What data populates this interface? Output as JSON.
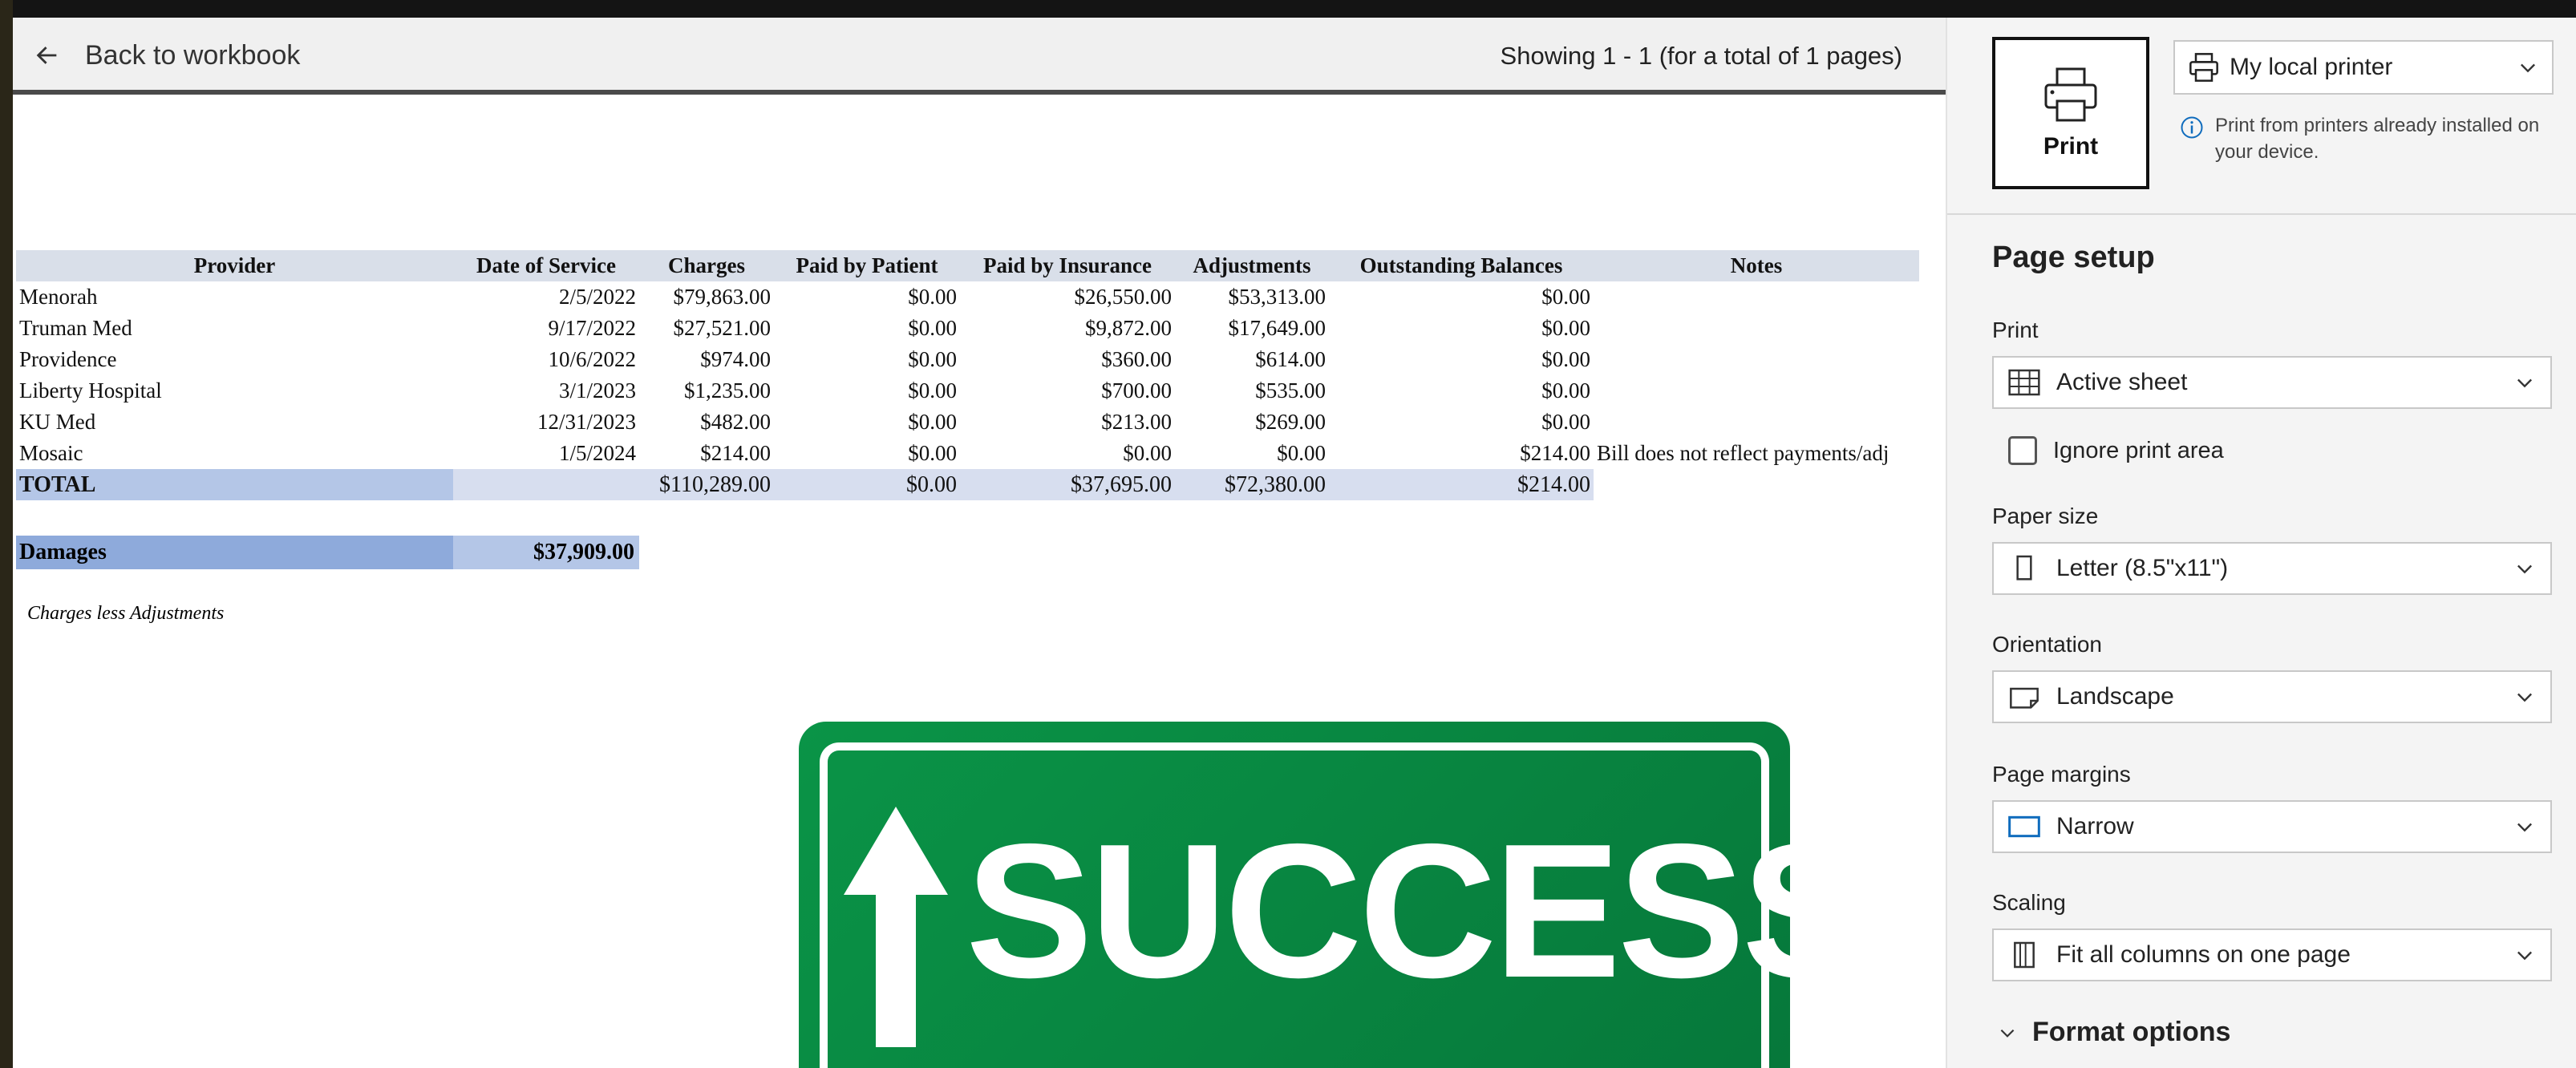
{
  "toolbar": {
    "back_label": "Back to workbook",
    "pages_info": "Showing 1 - 1 (for a total of 1 pages)"
  },
  "sheet": {
    "headers": [
      "Provider",
      "Date of Service",
      "Charges",
      "Paid by Patient",
      "Paid by Insurance",
      "Adjustments",
      "Outstanding Balances",
      "Notes"
    ],
    "rows": [
      [
        "Menorah",
        "2/5/2022",
        "$79,863.00",
        "$0.00",
        "$26,550.00",
        "$53,313.00",
        "$0.00",
        ""
      ],
      [
        "Truman Med",
        "9/17/2022",
        "$27,521.00",
        "$0.00",
        "$9,872.00",
        "$17,649.00",
        "$0.00",
        ""
      ],
      [
        "Providence",
        "10/6/2022",
        "$974.00",
        "$0.00",
        "$360.00",
        "$614.00",
        "$0.00",
        ""
      ],
      [
        "Liberty Hospital",
        "3/1/2023",
        "$1,235.00",
        "$0.00",
        "$700.00",
        "$535.00",
        "$0.00",
        ""
      ],
      [
        "KU Med",
        "12/31/2023",
        "$482.00",
        "$0.00",
        "$213.00",
        "$269.00",
        "$0.00",
        ""
      ],
      [
        "Mosaic",
        "1/5/2024",
        "$214.00",
        "$0.00",
        "$0.00",
        "$0.00",
        "$214.00",
        "Bill does not reflect payments/adj"
      ]
    ],
    "total": {
      "label": "TOTAL",
      "charges": "$110,289.00",
      "paid_by_patient": "$0.00",
      "paid_by_insurance": "$37,695.00",
      "adjustments": "$72,380.00",
      "outstanding": "$214.00"
    },
    "damages": {
      "label": "Damages",
      "value": "$37,909.00"
    },
    "footnote": "Charges less Adjustments"
  },
  "sign": {
    "text": "SUCCESS"
  },
  "panel": {
    "print_button_label": "Print",
    "printer_select": "My local printer",
    "printer_info": "Print from printers already installed on your device.",
    "section_title": "Page setup",
    "print_label": "Print",
    "print_value": "Active sheet",
    "ignore_print_area": "Ignore print area",
    "paper_size_label": "Paper size",
    "paper_size_value": "Letter (8.5\"x11\")",
    "orientation_label": "Orientation",
    "orientation_value": "Landscape",
    "margins_label": "Page margins",
    "margins_value": "Narrow",
    "scaling_label": "Scaling",
    "scaling_value": "Fit all columns on one page",
    "format_options": "Format options"
  }
}
